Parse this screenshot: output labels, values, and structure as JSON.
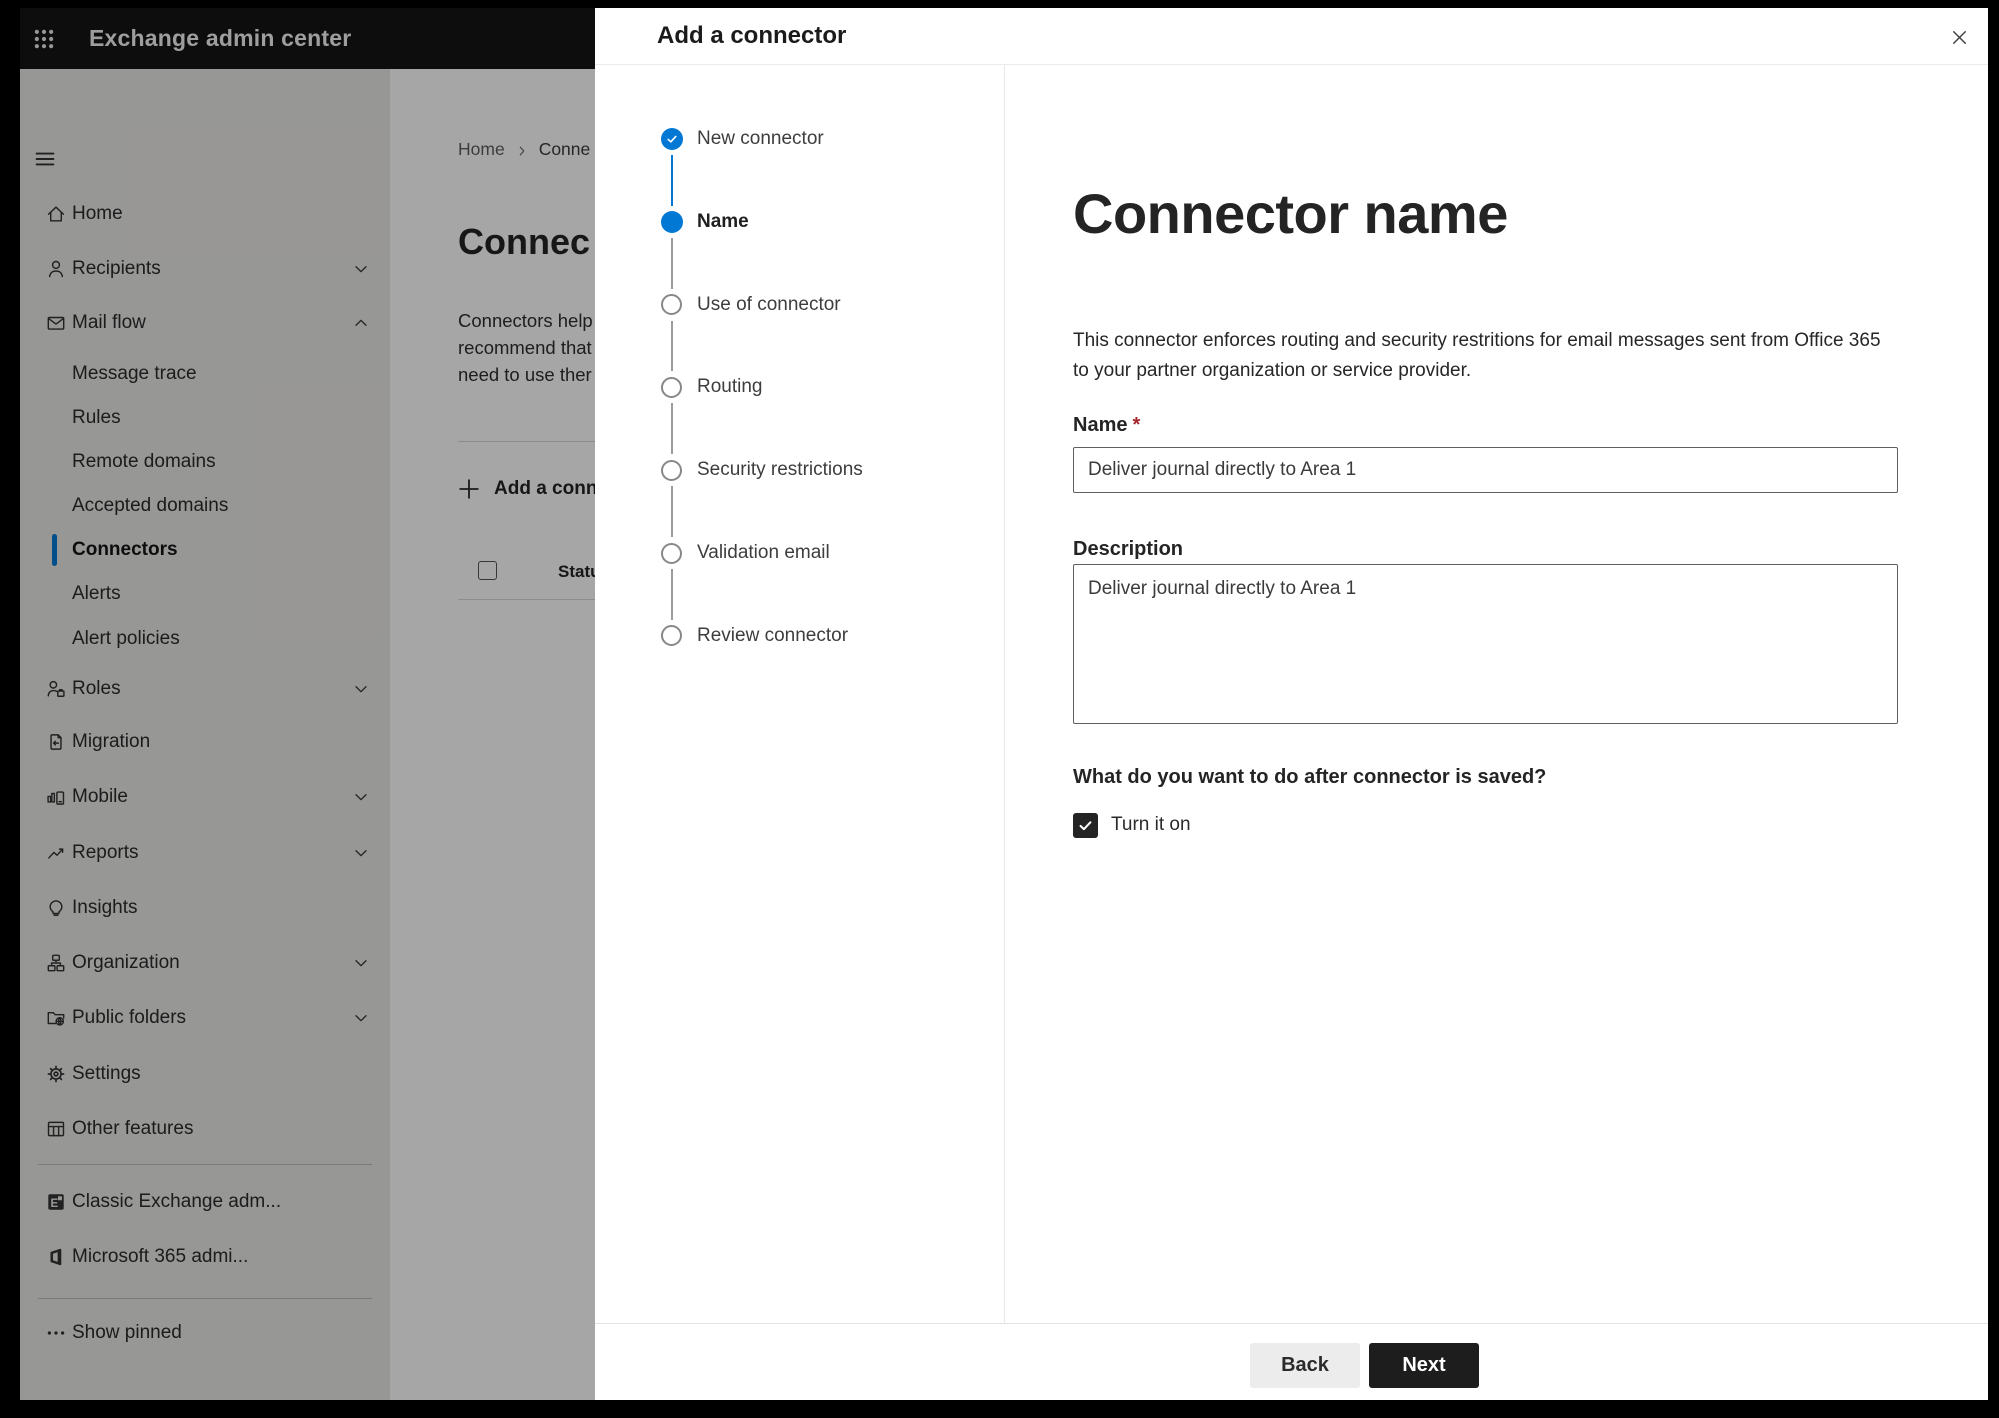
{
  "topbar": {
    "title": "Exchange admin center"
  },
  "sidebar": {
    "items": [
      {
        "label": "Home",
        "icon": "home-icon",
        "chevron": null,
        "sub": false,
        "selected": false
      },
      {
        "label": "Recipients",
        "icon": "person-icon",
        "chevron": "down",
        "sub": false,
        "selected": false
      },
      {
        "label": "Mail flow",
        "icon": "mail-icon",
        "chevron": "up",
        "sub": false,
        "selected": false
      },
      {
        "label": "Message trace",
        "icon": null,
        "chevron": null,
        "sub": true,
        "selected": false
      },
      {
        "label": "Rules",
        "icon": null,
        "chevron": null,
        "sub": true,
        "selected": false
      },
      {
        "label": "Remote domains",
        "icon": null,
        "chevron": null,
        "sub": true,
        "selected": false
      },
      {
        "label": "Accepted domains",
        "icon": null,
        "chevron": null,
        "sub": true,
        "selected": false
      },
      {
        "label": "Connectors",
        "icon": null,
        "chevron": null,
        "sub": true,
        "selected": true
      },
      {
        "label": "Alerts",
        "icon": null,
        "chevron": null,
        "sub": true,
        "selected": false
      },
      {
        "label": "Alert policies",
        "icon": null,
        "chevron": null,
        "sub": true,
        "selected": false
      },
      {
        "label": "Roles",
        "icon": "roles-icon",
        "chevron": "down",
        "sub": false,
        "selected": false
      },
      {
        "label": "Migration",
        "icon": "migration-icon",
        "chevron": null,
        "sub": false,
        "selected": false
      },
      {
        "label": "Mobile",
        "icon": "mobile-icon",
        "chevron": "down",
        "sub": false,
        "selected": false
      },
      {
        "label": "Reports",
        "icon": "reports-icon",
        "chevron": "down",
        "sub": false,
        "selected": false
      },
      {
        "label": "Insights",
        "icon": "insights-icon",
        "chevron": null,
        "sub": false,
        "selected": false
      },
      {
        "label": "Organization",
        "icon": "organization-icon",
        "chevron": "down",
        "sub": false,
        "selected": false
      },
      {
        "label": "Public folders",
        "icon": "public-folders-icon",
        "chevron": "down",
        "sub": false,
        "selected": false
      },
      {
        "label": "Settings",
        "icon": "gear-icon",
        "chevron": null,
        "sub": false,
        "selected": false
      },
      {
        "label": "Other features",
        "icon": "table-icon",
        "chevron": null,
        "sub": false,
        "selected": false
      },
      {
        "label": "Classic Exchange adm...",
        "icon": "exchange-logo-icon",
        "chevron": null,
        "sub": false,
        "selected": false
      },
      {
        "label": "Microsoft 365 admi...",
        "icon": "m365-logo-icon",
        "chevron": null,
        "sub": false,
        "selected": false
      },
      {
        "label": "Show pinned",
        "icon": "ellipsis-icon",
        "chevron": null,
        "sub": false,
        "selected": false
      }
    ]
  },
  "page": {
    "breadcrumb": {
      "home": "Home",
      "current": "Conne"
    },
    "title": "Connec",
    "paragraph": "Connectors help\nrecommend that\nneed to use ther",
    "add_button_label": "Add a conn",
    "status_column": "Status"
  },
  "dialog": {
    "title": "Add a connector",
    "steps": [
      {
        "label": "New connector",
        "state": "completed"
      },
      {
        "label": "Name",
        "state": "current"
      },
      {
        "label": "Use of connector",
        "state": "upcoming"
      },
      {
        "label": "Routing",
        "state": "upcoming"
      },
      {
        "label": "Security restrictions",
        "state": "upcoming"
      },
      {
        "label": "Validation email",
        "state": "upcoming"
      },
      {
        "label": "Review connector",
        "state": "upcoming"
      }
    ],
    "content": {
      "heading": "Connector name",
      "description": "This connector enforces routing and security restritions for email messages sent from Office 365\nto your partner organization or service provider.",
      "name_label": "Name",
      "required_mark": "*",
      "name_value": "Deliver journal directly to Area 1",
      "description_label": "Description",
      "description_value": "Deliver journal directly to Area 1",
      "question": "What do you want to do after connector is saved?",
      "checkbox_label": "Turn it on",
      "checkbox_checked": true
    },
    "footer": {
      "back_label": "Back",
      "next_label": "Next"
    }
  },
  "colors": {
    "accent_blue": "#0078d4",
    "topbar_bg": "#141414",
    "primary_button_bg": "#1d1d1d",
    "required_red": "#a4262c",
    "checkbox_bg": "#242424"
  }
}
